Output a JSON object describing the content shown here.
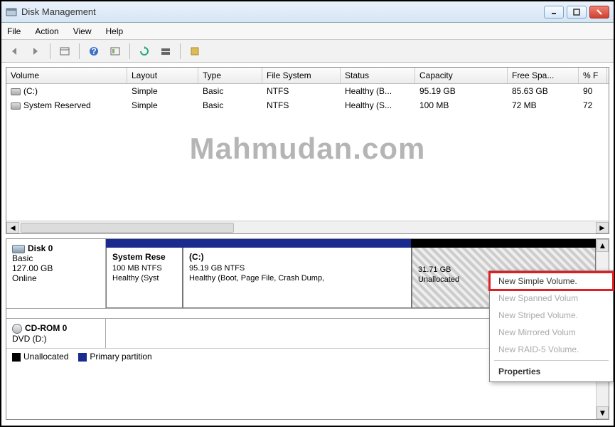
{
  "window": {
    "title": "Disk Management"
  },
  "menubar": [
    "File",
    "Action",
    "View",
    "Help"
  ],
  "table": {
    "headers": [
      "Volume",
      "Layout",
      "Type",
      "File System",
      "Status",
      "Capacity",
      "Free Spa...",
      "% F"
    ],
    "rows": [
      {
        "volume": "(C:)",
        "layout": "Simple",
        "type": "Basic",
        "fs": "NTFS",
        "status": "Healthy (B...",
        "capacity": "95.19 GB",
        "free": "85.63 GB",
        "pct": "90"
      },
      {
        "volume": "System Reserved",
        "layout": "Simple",
        "type": "Basic",
        "fs": "NTFS",
        "status": "Healthy (S...",
        "capacity": "100 MB",
        "free": "72 MB",
        "pct": "72"
      }
    ]
  },
  "watermark": "Mahmudan.com",
  "disk0": {
    "name": "Disk 0",
    "type": "Basic",
    "size": "127.00 GB",
    "status": "Online",
    "partitions": [
      {
        "title": "System Rese",
        "line1": "100 MB NTFS",
        "line2": "Healthy (Syst"
      },
      {
        "title": "(C:)",
        "line1": "95.19 GB NTFS",
        "line2": "Healthy (Boot, Page File, Crash Dump,"
      },
      {
        "title": "",
        "line1": "31.71 GB",
        "line2": "Unallocated"
      }
    ]
  },
  "cdrom": {
    "name": "CD-ROM 0",
    "line": "DVD (D:)"
  },
  "legend": {
    "unalloc": "Unallocated",
    "primary": "Primary partition"
  },
  "context_menu": {
    "items": [
      {
        "label": "New Simple Volume.",
        "enabled": true,
        "highlight": true
      },
      {
        "label": "New Spanned Volum",
        "enabled": false
      },
      {
        "label": "New Striped Volume.",
        "enabled": false
      },
      {
        "label": "New Mirrored Volum",
        "enabled": false
      },
      {
        "label": "New RAID-5 Volume.",
        "enabled": false
      }
    ],
    "properties": "Properties"
  }
}
